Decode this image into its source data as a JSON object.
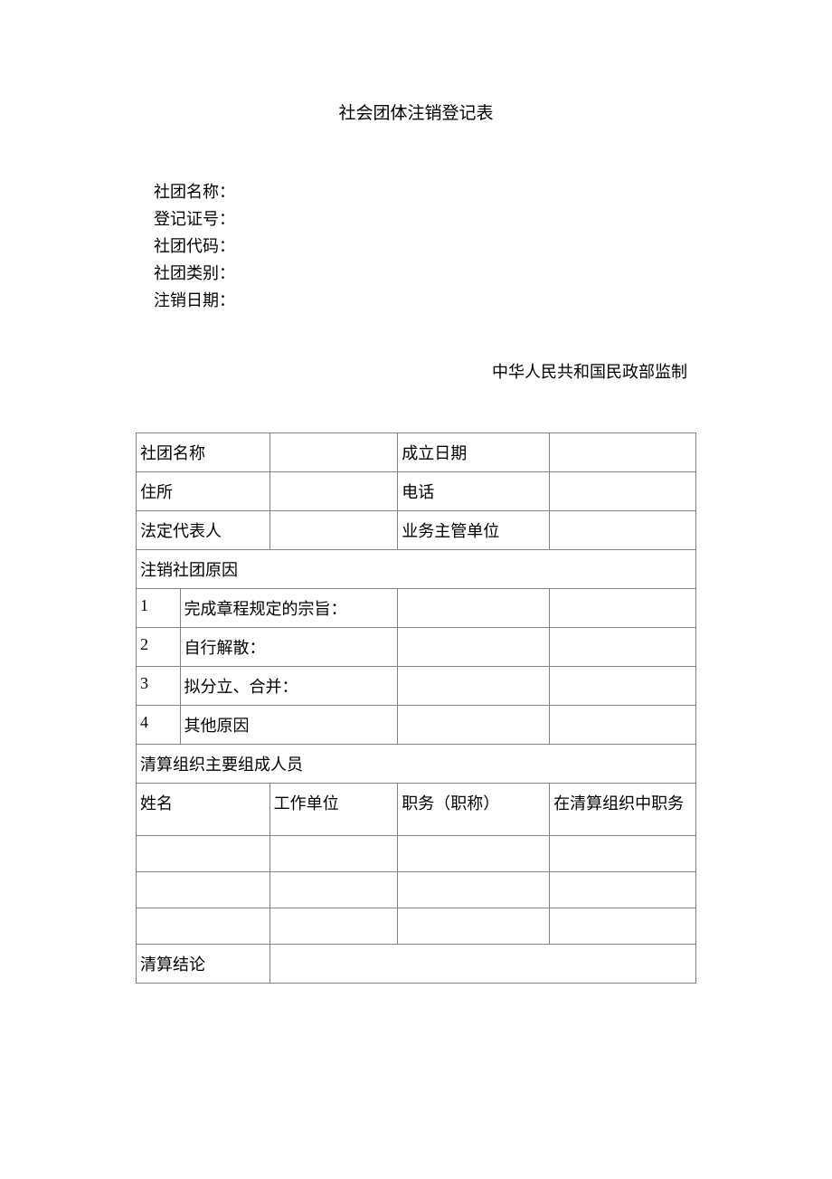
{
  "title": "社会团体注销登记表",
  "header_fields": {
    "name_label": "社团名称：",
    "reg_no_label": "登记证号：",
    "code_label": "社团代码：",
    "category_label": "社团类别：",
    "cancel_date_label": "注销日期："
  },
  "supervisor": "中华人民共和国民政部监制",
  "table": {
    "row1": {
      "label1": "社团名称",
      "value1": "",
      "label2": "成立日期",
      "value2": ""
    },
    "row2": {
      "label1": "住所",
      "value1": "",
      "label2": "电话",
      "value2": ""
    },
    "row3": {
      "label1": "法定代表人",
      "value1": "",
      "label2": "业务主管单位",
      "value2": ""
    },
    "reason_header": "注销社团原因",
    "reasons": [
      {
        "num": "1",
        "label": "完成章程规定的宗旨：",
        "val1": "",
        "val2": ""
      },
      {
        "num": "2",
        "label": "自行解散：",
        "val1": "",
        "val2": ""
      },
      {
        "num": "3",
        "label": "拟分立、合并：",
        "val1": "",
        "val2": ""
      },
      {
        "num": "4",
        "label": "其他原因",
        "val1": "",
        "val2": ""
      }
    ],
    "members_header": "清算组织主要组成人员",
    "members_cols": {
      "c1": "姓名",
      "c2": "工作单位",
      "c3": "职务（职称）",
      "c4": "在清算组织中职务"
    },
    "members_rows": [
      {
        "c1": "",
        "c2": "",
        "c3": "",
        "c4": ""
      },
      {
        "c1": "",
        "c2": "",
        "c3": "",
        "c4": ""
      },
      {
        "c1": "",
        "c2": "",
        "c3": "",
        "c4": ""
      }
    ],
    "conclusion": {
      "label": "清算结论",
      "value": ""
    }
  }
}
